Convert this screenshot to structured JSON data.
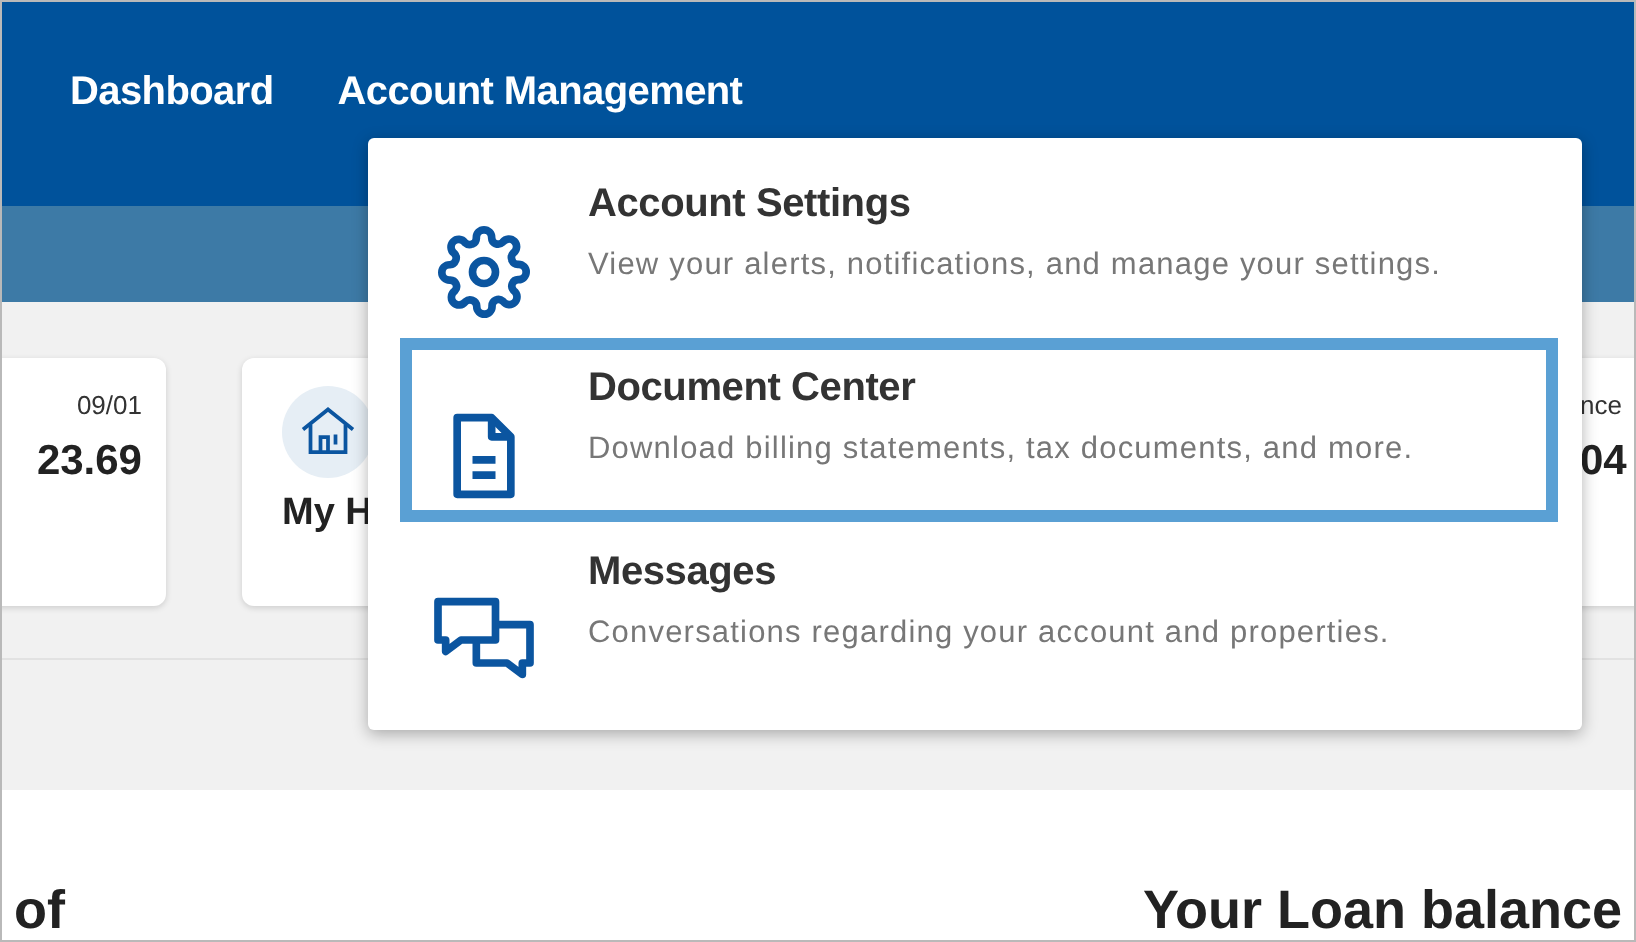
{
  "nav": {
    "items": [
      {
        "label": "Dashboard"
      },
      {
        "label": "Account Management"
      }
    ]
  },
  "dropdown": {
    "items": [
      {
        "kind": "gear",
        "title": "Account Settings",
        "description": "View your alerts, notifications, and manage your settings.",
        "selected": false
      },
      {
        "kind": "document",
        "title": "Document Center",
        "description": "Download billing statements, tax documents, and more.",
        "selected": true
      },
      {
        "kind": "chat",
        "title": "Messages",
        "description": "Conversations regarding your account and properties.",
        "selected": false
      }
    ]
  },
  "cards": [
    {
      "kind": "stat",
      "label": "09/01",
      "value": "23.69"
    },
    {
      "kind": "home",
      "label": "My H"
    },
    {
      "kind": "stat",
      "label": "nce",
      "value": "04"
    }
  ],
  "sections": [
    {
      "title": "of"
    },
    {
      "title": "Your Loan balance"
    }
  ]
}
